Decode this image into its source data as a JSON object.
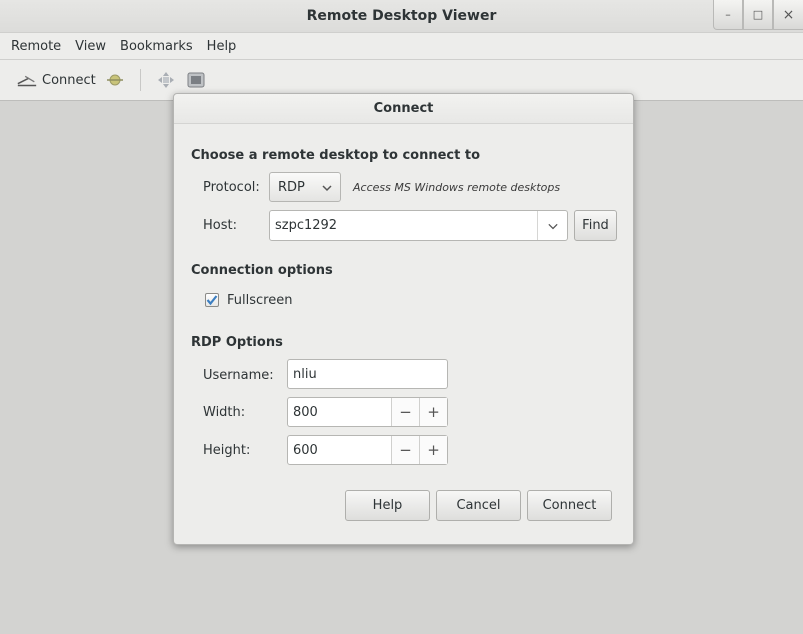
{
  "window": {
    "title": "Remote Desktop Viewer",
    "controls": {
      "minimize": "–",
      "maximize": "□",
      "close": "×"
    }
  },
  "menubar": {
    "items": [
      {
        "label": "Remote"
      },
      {
        "label": "View"
      },
      {
        "label": "Bookmarks"
      },
      {
        "label": "Help"
      }
    ]
  },
  "toolbar": {
    "connect_label": "Connect",
    "icons": [
      "connect-icon",
      "disconnect-icon",
      "move-icon",
      "screenshot-icon"
    ]
  },
  "dialog": {
    "title": "Connect",
    "choose_section": "Choose a remote desktop to connect to",
    "protocol": {
      "label": "Protocol:",
      "selected": "RDP",
      "hint": "Access MS Windows remote desktops"
    },
    "host": {
      "label": "Host:",
      "value": "szpc1292",
      "find_label": "Find"
    },
    "connection_options": {
      "title": "Connection options",
      "fullscreen_label": "Fullscreen",
      "fullscreen_checked": true
    },
    "rdp_options": {
      "title": "RDP Options",
      "username_label": "Username:",
      "username_value": "nliu",
      "width_label": "Width:",
      "width_value": "800",
      "height_label": "Height:",
      "height_value": "600",
      "minus": "−",
      "plus": "+"
    },
    "buttons": {
      "help": "Help",
      "cancel": "Cancel",
      "connect": "Connect"
    }
  },
  "colors": {
    "window_bg": "#ededeb",
    "content_bg": "#d3d3d1",
    "checkbox_check": "#3d7fc1"
  }
}
